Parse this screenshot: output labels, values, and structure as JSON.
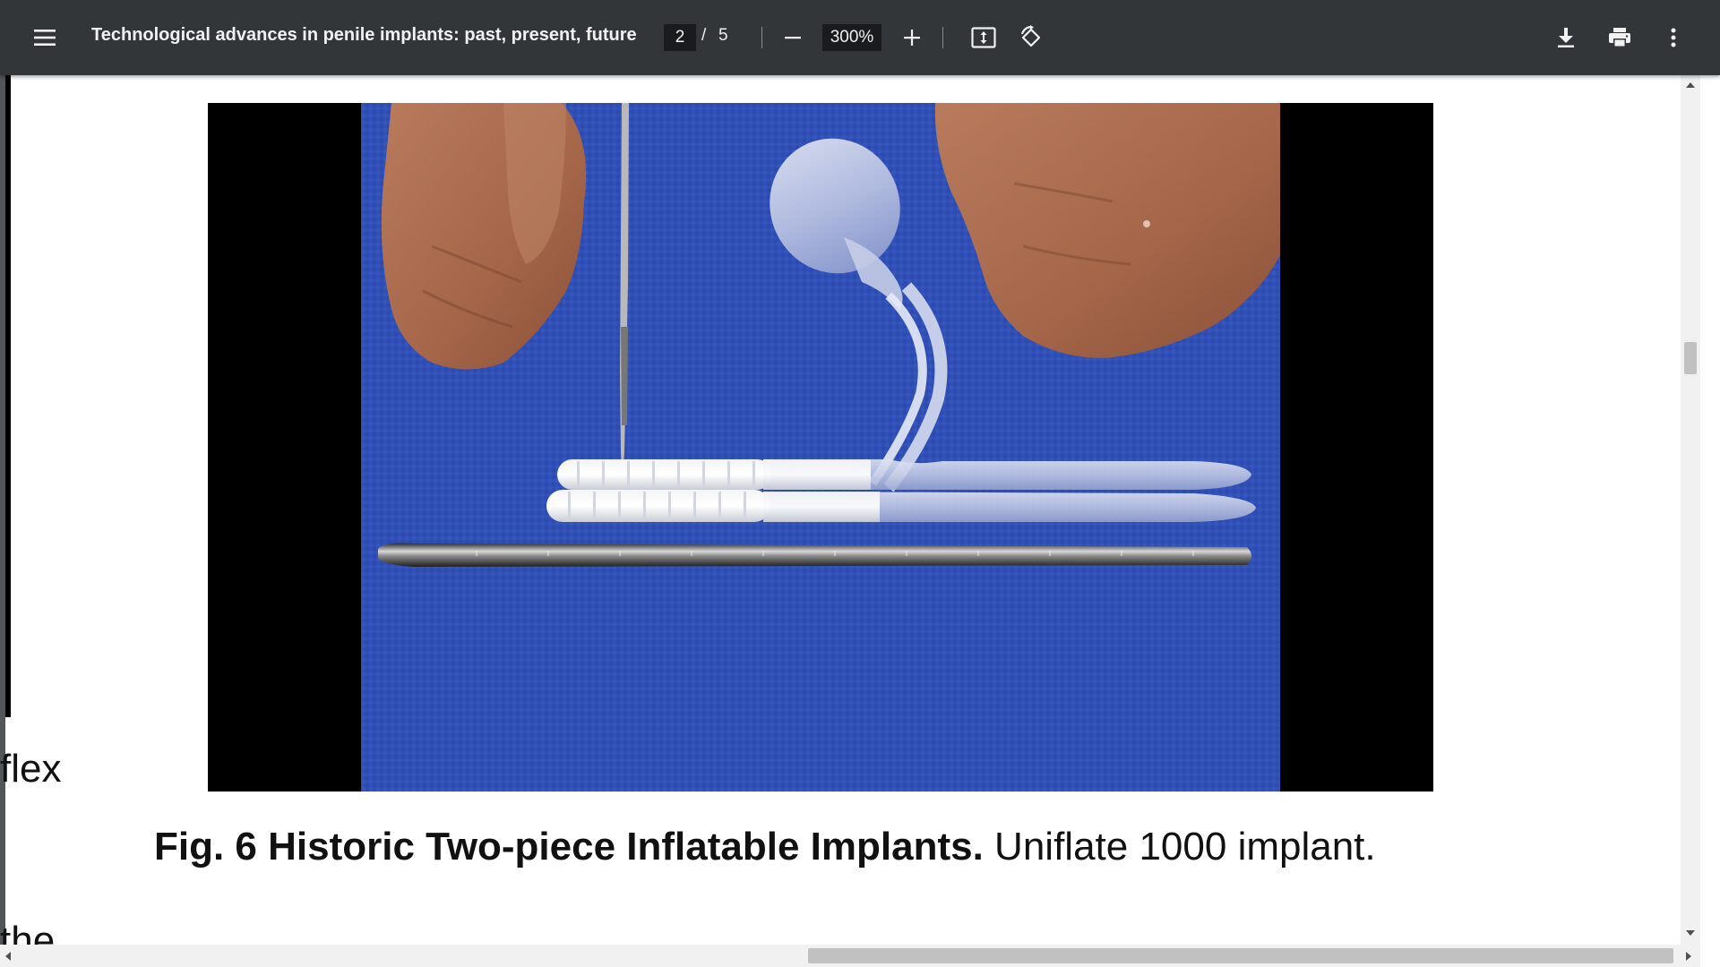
{
  "toolbar": {
    "title": "Technological advances in penile implants: past, present, future",
    "page_current": "2",
    "page_separator": "/",
    "page_total": "5",
    "zoom": "300%",
    "icons": {
      "menu": "hamburger-menu-icon",
      "zoom_out": "minus-icon",
      "zoom_in": "plus-icon",
      "fit": "fit-to-page-icon",
      "rotate": "rotate-counterclockwise-icon",
      "download": "download-icon",
      "print": "print-icon",
      "more": "more-vertical-icon"
    }
  },
  "document": {
    "left_fragments": [
      "flex",
      "the"
    ],
    "caption": {
      "label": "Fig. 6",
      "title": "Historic Two-piece Inflatable Implants.",
      "text": "Uniflate 1000 implant."
    }
  },
  "colors": {
    "toolbar_bg": "#323639",
    "viewer_bg": "#525659",
    "drape_blue": "#2f4fb8",
    "page_bg": "#ffffff"
  }
}
